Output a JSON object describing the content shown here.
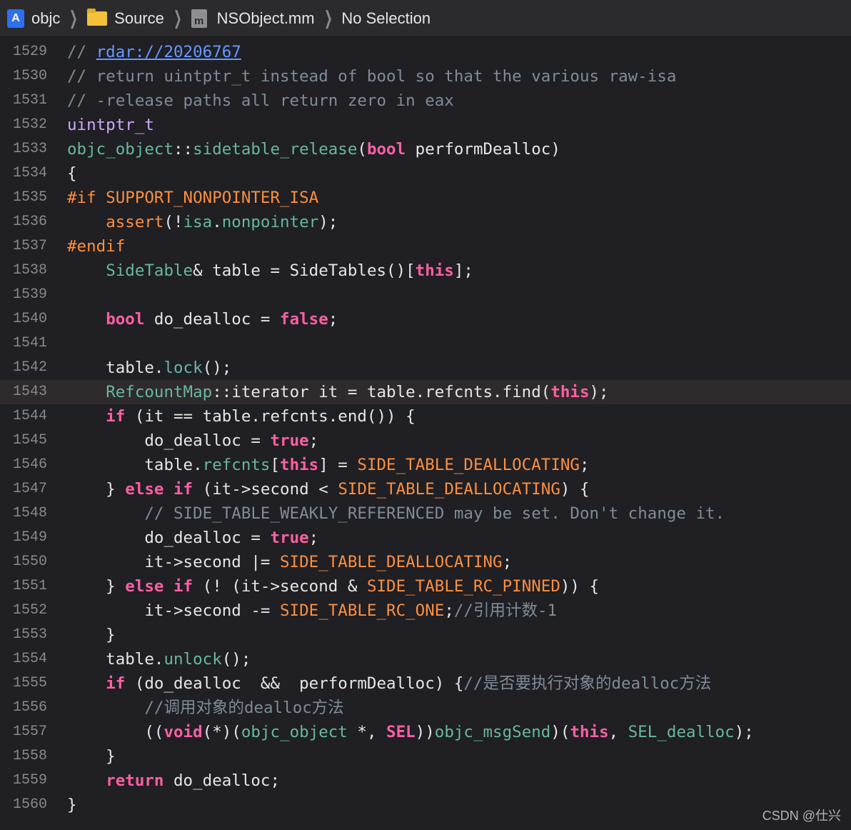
{
  "jumpbar": {
    "items": [
      {
        "label": "objc",
        "icon": "xcode-project-icon"
      },
      {
        "label": "Source",
        "icon": "folder-icon"
      },
      {
        "label": "NSObject.mm",
        "icon": "objc-file-icon"
      },
      {
        "label": "No Selection",
        "icon": ""
      }
    ]
  },
  "editor": {
    "current_line": "1543",
    "line_numbers": [
      "1529",
      "1530",
      "1531",
      "1532",
      "1533",
      "1534",
      "1535",
      "1536",
      "1537",
      "1538",
      "1539",
      "1540",
      "1541",
      "1542",
      "1543",
      "1544",
      "1545",
      "1546",
      "1547",
      "1548",
      "1549",
      "1550",
      "1551",
      "1552",
      "1553",
      "1554",
      "1555",
      "1556",
      "1557",
      "1558",
      "1559",
      "1560"
    ],
    "lines": [
      [
        {
          "t": "// ",
          "c": "c"
        },
        {
          "t": "rdar://20206767",
          "c": "u"
        }
      ],
      [
        {
          "t": "// return uintptr_t instead of bool so that the various raw-isa",
          "c": "c"
        }
      ],
      [
        {
          "t": "// -release paths all return zero in eax",
          "c": "c"
        }
      ],
      [
        {
          "t": "uintptr_t",
          "c": "t"
        }
      ],
      [
        {
          "t": "objc_object",
          "c": "f"
        },
        {
          "t": "::",
          "c": "pl"
        },
        {
          "t": "sidetable_release",
          "c": "f"
        },
        {
          "t": "(",
          "c": "pl"
        },
        {
          "t": "bool",
          "c": "k"
        },
        {
          "t": " performDealloc)",
          "c": "pl"
        }
      ],
      [
        {
          "t": "{",
          "c": "pl"
        }
      ],
      [
        {
          "t": "#if SUPPORT_NONPOINTER_ISA",
          "c": "p"
        }
      ],
      [
        {
          "t": "    ",
          "c": "pl"
        },
        {
          "t": "assert",
          "c": "p"
        },
        {
          "t": "(!",
          "c": "pl"
        },
        {
          "t": "isa",
          "c": "f"
        },
        {
          "t": ".",
          "c": "pl"
        },
        {
          "t": "nonpointer",
          "c": "f"
        },
        {
          "t": ");",
          "c": "pl"
        }
      ],
      [
        {
          "t": "#endif",
          "c": "p"
        }
      ],
      [
        {
          "t": "    ",
          "c": "pl"
        },
        {
          "t": "SideTable",
          "c": "f"
        },
        {
          "t": "& table = SideTables()[",
          "c": "pl"
        },
        {
          "t": "this",
          "c": "k"
        },
        {
          "t": "];",
          "c": "pl"
        }
      ],
      [],
      [
        {
          "t": "    ",
          "c": "pl"
        },
        {
          "t": "bool",
          "c": "k"
        },
        {
          "t": " do_dealloc = ",
          "c": "pl"
        },
        {
          "t": "false",
          "c": "k"
        },
        {
          "t": ";",
          "c": "pl"
        }
      ],
      [],
      [
        {
          "t": "    table.",
          "c": "pl"
        },
        {
          "t": "lock",
          "c": "f"
        },
        {
          "t": "();",
          "c": "pl"
        }
      ],
      [
        {
          "t": "    ",
          "c": "pl"
        },
        {
          "t": "RefcountMap",
          "c": "f"
        },
        {
          "t": "::iterator it = table.refcnts.find(",
          "c": "pl"
        },
        {
          "t": "this",
          "c": "k"
        },
        {
          "t": ");",
          "c": "pl"
        }
      ],
      [
        {
          "t": "    ",
          "c": "pl"
        },
        {
          "t": "if",
          "c": "k"
        },
        {
          "t": " (it == table.refcnts.end()) {",
          "c": "pl"
        }
      ],
      [
        {
          "t": "        do_dealloc = ",
          "c": "pl"
        },
        {
          "t": "true",
          "c": "k"
        },
        {
          "t": ";",
          "c": "pl"
        }
      ],
      [
        {
          "t": "        table.",
          "c": "pl"
        },
        {
          "t": "refcnts",
          "c": "f"
        },
        {
          "t": "[",
          "c": "pl"
        },
        {
          "t": "this",
          "c": "k"
        },
        {
          "t": "] = ",
          "c": "pl"
        },
        {
          "t": "SIDE_TABLE_DEALLOCATING",
          "c": "p"
        },
        {
          "t": ";",
          "c": "pl"
        }
      ],
      [
        {
          "t": "    } ",
          "c": "pl"
        },
        {
          "t": "else",
          "c": "k"
        },
        {
          "t": " ",
          "c": "pl"
        },
        {
          "t": "if",
          "c": "k"
        },
        {
          "t": " (it->second < ",
          "c": "pl"
        },
        {
          "t": "SIDE_TABLE_DEALLOCATING",
          "c": "p"
        },
        {
          "t": ") {",
          "c": "pl"
        }
      ],
      [
        {
          "t": "        ",
          "c": "pl"
        },
        {
          "t": "// SIDE_TABLE_WEAKLY_REFERENCED may be set. Don't change it.",
          "c": "c"
        }
      ],
      [
        {
          "t": "        do_dealloc = ",
          "c": "pl"
        },
        {
          "t": "true",
          "c": "k"
        },
        {
          "t": ";",
          "c": "pl"
        }
      ],
      [
        {
          "t": "        it->second |= ",
          "c": "pl"
        },
        {
          "t": "SIDE_TABLE_DEALLOCATING",
          "c": "p"
        },
        {
          "t": ";",
          "c": "pl"
        }
      ],
      [
        {
          "t": "    } ",
          "c": "pl"
        },
        {
          "t": "else",
          "c": "k"
        },
        {
          "t": " ",
          "c": "pl"
        },
        {
          "t": "if",
          "c": "k"
        },
        {
          "t": " (! (it->second & ",
          "c": "pl"
        },
        {
          "t": "SIDE_TABLE_RC_PINNED",
          "c": "p"
        },
        {
          "t": ")) {",
          "c": "pl"
        }
      ],
      [
        {
          "t": "        it->second -= ",
          "c": "pl"
        },
        {
          "t": "SIDE_TABLE_RC_ONE",
          "c": "p"
        },
        {
          "t": ";",
          "c": "pl"
        },
        {
          "t": "//引用计数-1",
          "c": "c"
        }
      ],
      [
        {
          "t": "    }",
          "c": "pl"
        }
      ],
      [
        {
          "t": "    table.",
          "c": "pl"
        },
        {
          "t": "unlock",
          "c": "f"
        },
        {
          "t": "();",
          "c": "pl"
        }
      ],
      [
        {
          "t": "    ",
          "c": "pl"
        },
        {
          "t": "if",
          "c": "k"
        },
        {
          "t": " (do_dealloc  &&  performDealloc) {",
          "c": "pl"
        },
        {
          "t": "//是否要执行对象的dealloc方法",
          "c": "c"
        }
      ],
      [
        {
          "t": "        ",
          "c": "pl"
        },
        {
          "t": "//调用对象的dealloc方法",
          "c": "c"
        }
      ],
      [
        {
          "t": "        ((",
          "c": "pl"
        },
        {
          "t": "void",
          "c": "k"
        },
        {
          "t": "(*)(",
          "c": "pl"
        },
        {
          "t": "objc_object",
          "c": "f"
        },
        {
          "t": " *, ",
          "c": "pl"
        },
        {
          "t": "SEL",
          "c": "k"
        },
        {
          "t": "))",
          "c": "pl"
        },
        {
          "t": "objc_msgSend",
          "c": "f"
        },
        {
          "t": ")(",
          "c": "pl"
        },
        {
          "t": "this",
          "c": "k"
        },
        {
          "t": ", ",
          "c": "pl"
        },
        {
          "t": "SEL_dealloc",
          "c": "f"
        },
        {
          "t": ");",
          "c": "pl"
        }
      ],
      [
        {
          "t": "    }",
          "c": "pl"
        }
      ],
      [
        {
          "t": "    ",
          "c": "pl"
        },
        {
          "t": "return",
          "c": "k"
        },
        {
          "t": " do_dealloc;",
          "c": "pl"
        }
      ],
      [
        {
          "t": "}",
          "c": "pl"
        }
      ]
    ]
  },
  "watermark": "CSDN @仕兴"
}
